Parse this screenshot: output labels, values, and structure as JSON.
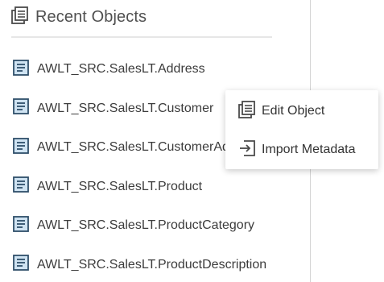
{
  "panel": {
    "title": "Recent Objects",
    "title_icon": "recent-objects-icon",
    "items": [
      {
        "label": "AWLT_SRC.SalesLT.Address",
        "icon": "table-object-icon"
      },
      {
        "label": "AWLT_SRC.SalesLT.Customer",
        "icon": "table-object-icon"
      },
      {
        "label": "AWLT_SRC.SalesLT.CustomerAddress",
        "icon": "table-object-icon"
      },
      {
        "label": "AWLT_SRC.SalesLT.Product",
        "icon": "table-object-icon"
      },
      {
        "label": "AWLT_SRC.SalesLT.ProductCategory",
        "icon": "table-object-icon"
      },
      {
        "label": "AWLT_SRC.SalesLT.ProductDescription",
        "icon": "table-object-icon"
      }
    ]
  },
  "context_menu": {
    "items": [
      {
        "label": "Edit Object",
        "icon": "edit-object-icon"
      },
      {
        "label": "Import Metadata",
        "icon": "import-metadata-icon"
      }
    ]
  },
  "colors": {
    "icon_fill": "#cfe3f2",
    "icon_stroke": "#2f4f6a",
    "text": "#3c3c3c"
  }
}
